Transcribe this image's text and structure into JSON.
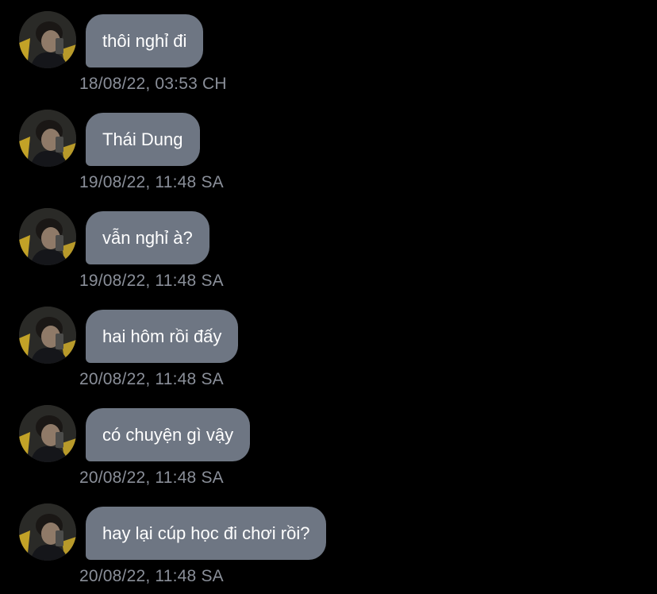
{
  "messages": [
    {
      "text": "thôi nghỉ đi",
      "time": "18/08/22, 03:53 CH"
    },
    {
      "text": "Thái Dung",
      "time": "19/08/22, 11:48 SA"
    },
    {
      "text": "vẫn nghỉ à?",
      "time": "19/08/22, 11:48 SA"
    },
    {
      "text": "hai hôm rồi đấy",
      "time": "20/08/22, 11:48 SA"
    },
    {
      "text": "có chuyện gì vậy",
      "time": "20/08/22, 11:48 SA"
    },
    {
      "text": "hay lại cúp học đi chơi rồi?",
      "time": "20/08/22, 11:48 SA"
    }
  ],
  "colors": {
    "background": "#000000",
    "bubble": "#6e7683",
    "bubble_text": "#ffffff",
    "timestamp": "#8a8f99"
  },
  "icons": {
    "avatar": "profile-photo"
  }
}
